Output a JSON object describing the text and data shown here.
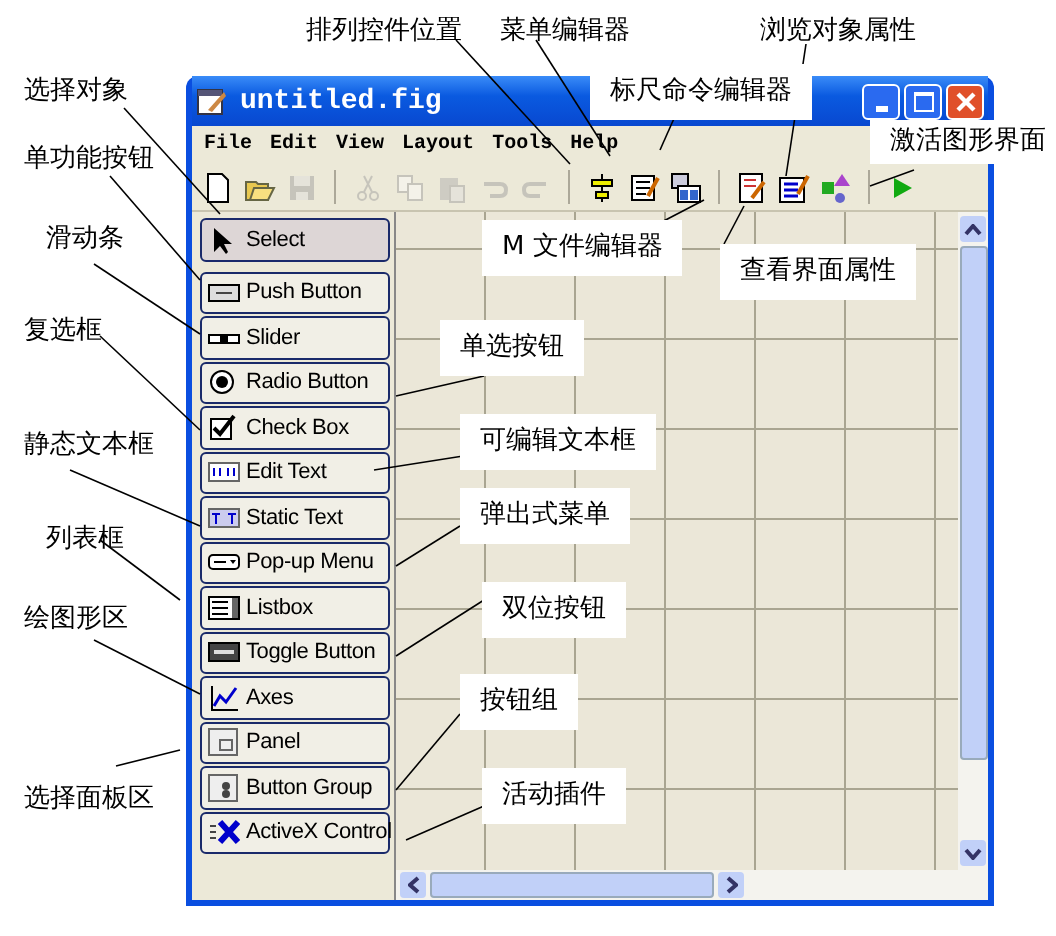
{
  "window": {
    "title": "untitled.fig"
  },
  "menu": [
    "File",
    "Edit",
    "View",
    "Layout",
    "Tools",
    "Help"
  ],
  "toolbar": [
    {
      "kind": "new",
      "disabled": false
    },
    {
      "kind": "open",
      "disabled": false
    },
    {
      "kind": "save",
      "disabled": true
    },
    {
      "kind": "sep"
    },
    {
      "kind": "cut",
      "disabled": true
    },
    {
      "kind": "copy",
      "disabled": true
    },
    {
      "kind": "paste",
      "disabled": true
    },
    {
      "kind": "undo",
      "disabled": true
    },
    {
      "kind": "redo",
      "disabled": true
    },
    {
      "kind": "sep"
    },
    {
      "kind": "align",
      "disabled": false
    },
    {
      "kind": "menu",
      "disabled": false
    },
    {
      "kind": "order",
      "disabled": false
    },
    {
      "kind": "sep"
    },
    {
      "kind": "mfile",
      "disabled": false
    },
    {
      "kind": "inspect",
      "disabled": false
    },
    {
      "kind": "browser",
      "disabled": false
    },
    {
      "kind": "sep"
    },
    {
      "kind": "run",
      "disabled": false
    }
  ],
  "palette": [
    {
      "label": "Select",
      "selected": true
    },
    {
      "label": "Push Button",
      "selected": false
    },
    {
      "label": "Slider",
      "selected": false
    },
    {
      "label": "Radio Button",
      "selected": false
    },
    {
      "label": "Check Box",
      "selected": false
    },
    {
      "label": "Edit Text",
      "selected": false
    },
    {
      "label": "Static Text",
      "selected": false
    },
    {
      "label": "Pop-up Menu",
      "selected": false
    },
    {
      "label": "Listbox",
      "selected": false
    },
    {
      "label": "Toggle Button",
      "selected": false
    },
    {
      "label": "Axes",
      "selected": false
    },
    {
      "label": "Panel",
      "selected": false
    },
    {
      "label": "Button Group",
      "selected": false
    },
    {
      "label": "ActiveX Control",
      "selected": false
    }
  ],
  "callouts": [
    {
      "text": "排列控件位置"
    },
    {
      "text": "菜单编辑器"
    },
    {
      "text": "浏览对象属性"
    },
    {
      "text": "标尺命令编辑器"
    },
    {
      "text": "激活图形界面"
    },
    {
      "text": "选择对象"
    },
    {
      "text": "单功能按钮"
    },
    {
      "text": "滑动条"
    },
    {
      "text": "复选框"
    },
    {
      "text": "静态文本框"
    },
    {
      "text": "列表框"
    },
    {
      "text": "绘图形区"
    },
    {
      "text": "选择面板区"
    },
    {
      "text": "M 文件编辑器"
    },
    {
      "text": "查看界面属性"
    },
    {
      "text": "单选按钮"
    },
    {
      "text": "可编辑文本框"
    },
    {
      "text": "弹出式菜单"
    },
    {
      "text": "双位按钮"
    },
    {
      "text": "按钮组"
    },
    {
      "text": "活动插件"
    }
  ]
}
